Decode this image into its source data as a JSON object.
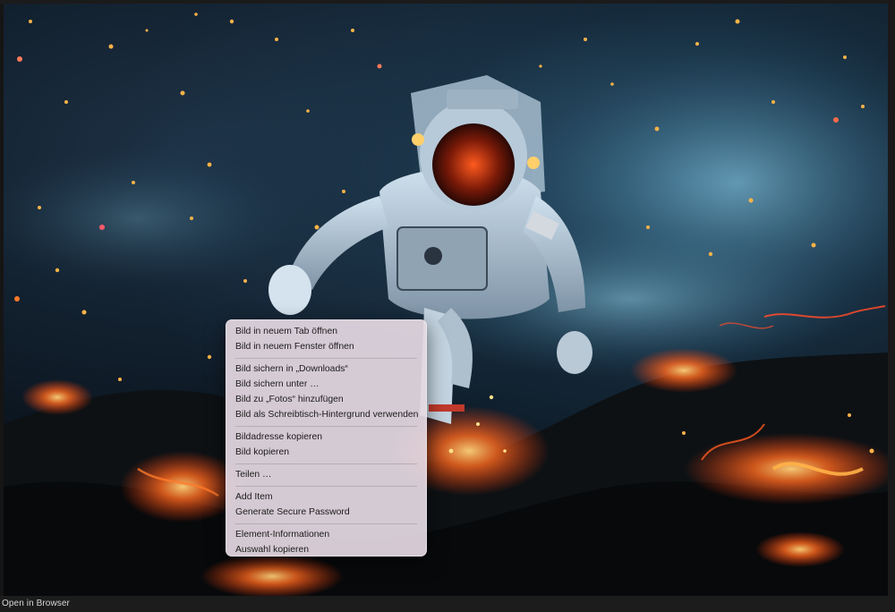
{
  "photo": {
    "subject": "astronaut-on-lava"
  },
  "context_menu": {
    "groups": [
      [
        "Bild in neuem Tab öffnen",
        "Bild in neuem Fenster öffnen"
      ],
      [
        "Bild sichern in „Downloads“",
        "Bild sichern unter …",
        "Bild zu „Fotos“ hinzufügen",
        "Bild als Schreibtisch-Hintergrund verwenden"
      ],
      [
        "Bildadresse kopieren",
        "Bild kopieren"
      ],
      [
        "Teilen …"
      ],
      [
        "Add Item",
        "Generate Secure Password"
      ],
      [
        "Element-Informationen",
        "Auswahl kopieren"
      ]
    ]
  },
  "bottom_bar": {
    "open_in_browser": "Open in Browser"
  },
  "colors": {
    "lava": "#ff5a1f",
    "ember": "#ffb347",
    "smoke": "#5aa7c8",
    "menu_bg": "#e4d8e2"
  }
}
